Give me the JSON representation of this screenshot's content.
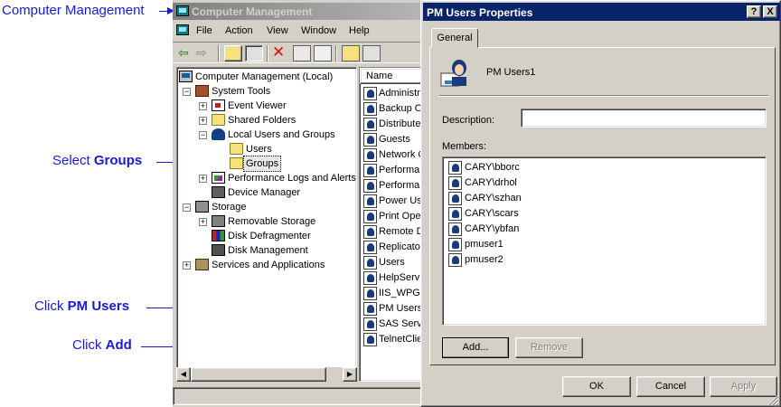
{
  "annotations": {
    "title": "Computer Management",
    "select_groups_prefix": "Select ",
    "select_groups_bold": "Groups",
    "click_pm_prefix": "Click ",
    "click_pm_bold": "PM Users",
    "click_add_prefix": "Click ",
    "click_add_bold": "Add",
    "color": "#1a1ad4"
  },
  "main_window": {
    "title": "Computer Management",
    "menu": [
      "File",
      "Action",
      "View",
      "Window",
      "Help"
    ],
    "tree": [
      {
        "label": "Computer Management (Local)",
        "icon": "computer-icon"
      },
      {
        "label": "System Tools",
        "icon": "tools-icon"
      },
      {
        "label": "Event Viewer",
        "icon": "event-viewer-icon"
      },
      {
        "label": "Shared Folders",
        "icon": "folder-icon"
      },
      {
        "label": "Local Users and Groups",
        "icon": "users-groups-icon"
      },
      {
        "label": "Users",
        "icon": "folder-icon"
      },
      {
        "label": "Groups",
        "icon": "folder-open-icon",
        "selected": true
      },
      {
        "label": "Performance Logs and Alerts",
        "icon": "performance-icon"
      },
      {
        "label": "Device Manager",
        "icon": "device-manager-icon"
      },
      {
        "label": "Storage",
        "icon": "storage-icon"
      },
      {
        "label": "Removable Storage",
        "icon": "removable-storage-icon"
      },
      {
        "label": "Disk Defragmenter",
        "icon": "defragmenter-icon"
      },
      {
        "label": "Disk Management",
        "icon": "disk-management-icon"
      },
      {
        "label": "Services and Applications",
        "icon": "services-icon"
      }
    ],
    "list_header": "Name",
    "list_items": [
      "Administrators",
      "Backup Operators",
      "Distributed COM Users",
      "Guests",
      "Network Configuration Operators",
      "Performance Log Users",
      "Performance Monitor Users",
      "Power Users",
      "Print Operators",
      "Remote Desktop Users",
      "Replicator",
      "Users",
      "HelpServicesGroup",
      "IIS_WPG",
      "PM Users",
      "SAS Server",
      "TelnetClients"
    ]
  },
  "dialog": {
    "title": "PM Users Properties",
    "help_btn": "?",
    "close_btn": "X",
    "tab": "General",
    "group_name": "PM Users1",
    "description_label": "Description:",
    "description_value": "",
    "members_label": "Members:",
    "members": [
      "CARY\\bborc",
      "CARY\\drhol",
      "CARY\\szhan",
      "CARY\\scars",
      "CARY\\ybfan",
      "pmuser1",
      "pmuser2"
    ],
    "add_btn": "Add...",
    "remove_btn": "Remove",
    "ok_btn": "OK",
    "cancel_btn": "Cancel",
    "apply_btn": "Apply",
    "title_color": "#0a246a"
  }
}
